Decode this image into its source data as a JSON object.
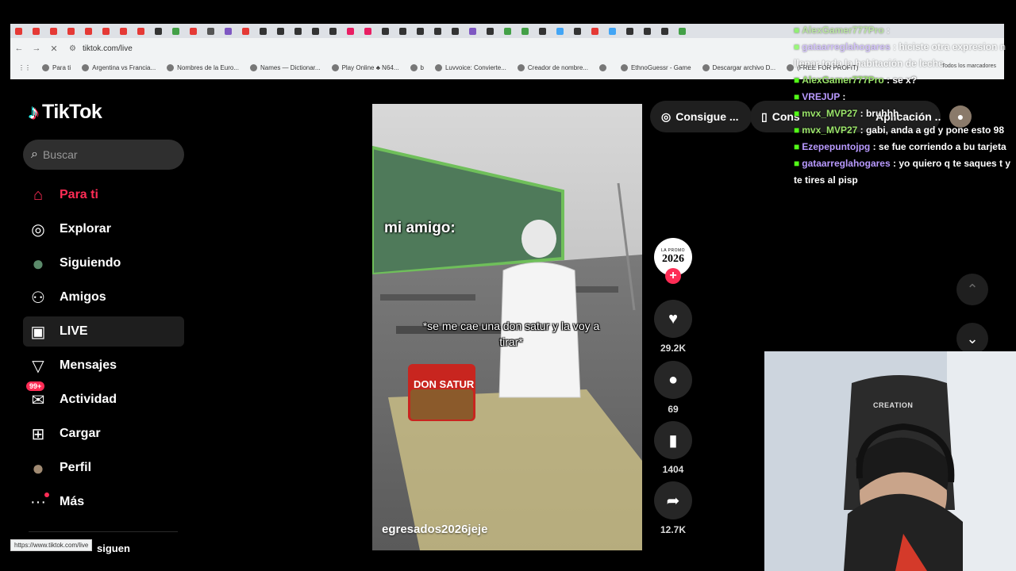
{
  "browser": {
    "url": "tiktok.com/live",
    "bookmarks": [
      "Para ti",
      "Argentina vs Francia...",
      "Nombres de la Euro...",
      "Names — Dictionar...",
      "Play Online ♣ N64...",
      "b",
      "Luvvoice: Convierte...",
      "Creador de nombre...",
      "",
      "EthnoGuessr - Game",
      "Descargar archivo D...",
      "(FREE FOR PROFIT)"
    ],
    "all_bookmarks": "Todos los marcadores",
    "status_url": "https://www.tiktok.com/live"
  },
  "tiktok": {
    "logo": "TikTok",
    "search_placeholder": "Buscar",
    "menu": [
      {
        "label": "Para ti",
        "icon": "home-icon",
        "glyph": "⌂"
      },
      {
        "label": "Explorar",
        "icon": "compass-icon",
        "glyph": "◎"
      },
      {
        "label": "Siguiendo",
        "icon": "following-avatar-icon",
        "glyph": "●"
      },
      {
        "label": "Amigos",
        "icon": "friends-icon",
        "glyph": "⚇"
      },
      {
        "label": "LIVE",
        "icon": "live-tv-icon",
        "glyph": "▣"
      },
      {
        "label": "Mensajes",
        "icon": "send-icon",
        "glyph": "▽"
      },
      {
        "label": "Actividad",
        "icon": "inbox-icon",
        "glyph": "✉"
      },
      {
        "label": "Cargar",
        "icon": "upload-plus-icon",
        "glyph": "⊞"
      },
      {
        "label": "Perfil",
        "icon": "profile-avatar-icon",
        "glyph": "●"
      },
      {
        "label": "Más",
        "icon": "more-icon",
        "glyph": "···"
      }
    ],
    "activity_badge": "99+",
    "follow_hint": "siguen",
    "pills": {
      "coins": "Consigue ...",
      "app": "Cons",
      "app_overlay": "Aplicación ..."
    },
    "video": {
      "caption": "egresados2026jeje",
      "meme_top": "mi amigo:",
      "meme_mid": "*se me cae una don satur y la voy a tirar*",
      "bag_label": "DON SATUR",
      "creator_avatar_top": "LA PROMO",
      "creator_avatar_year": "2026"
    },
    "actions": [
      {
        "name": "like",
        "count": "29.2K",
        "glyph": "♥"
      },
      {
        "name": "comment",
        "count": "69",
        "glyph": "●"
      },
      {
        "name": "save",
        "count": "1404",
        "glyph": "▮"
      },
      {
        "name": "share",
        "count": "12.7K",
        "glyph": "➦"
      }
    ]
  },
  "chat": [
    {
      "user": "AlexGamer777Pro",
      "text": ":",
      "color": "#9be56a",
      "faded": true
    },
    {
      "user": "gataarreglahogares",
      "text": ": hiciste otra expresion n llenar toda la habitación de leche",
      "color": "#b99aff",
      "faded": true
    },
    {
      "user": "AlexGamer777Pro",
      "text": ": se x?",
      "color": "#9be56a",
      "faded": false
    },
    {
      "user": "VREJUP",
      "text": ":",
      "color": "#b99aff",
      "faded": false
    },
    {
      "user": "mvx_MVP27",
      "text": ": bruhhh",
      "color": "#9be56a",
      "faded": false
    },
    {
      "user": "mvx_MVP27",
      "text": ": gabi, anda a gd y pone esto 98",
      "color": "#9be56a",
      "faded": false
    },
    {
      "user": "Ezepepuntojpg",
      "text": ": se fue corriendo a bu tarjeta",
      "color": "#b99aff",
      "faded": false
    },
    {
      "user": "gataarreglahogares",
      "text": ": yo quiero q te saques t y te tires al pisp",
      "color": "#b99aff",
      "faded": false
    }
  ],
  "webcam": {
    "chair_brand": "CREATION"
  }
}
